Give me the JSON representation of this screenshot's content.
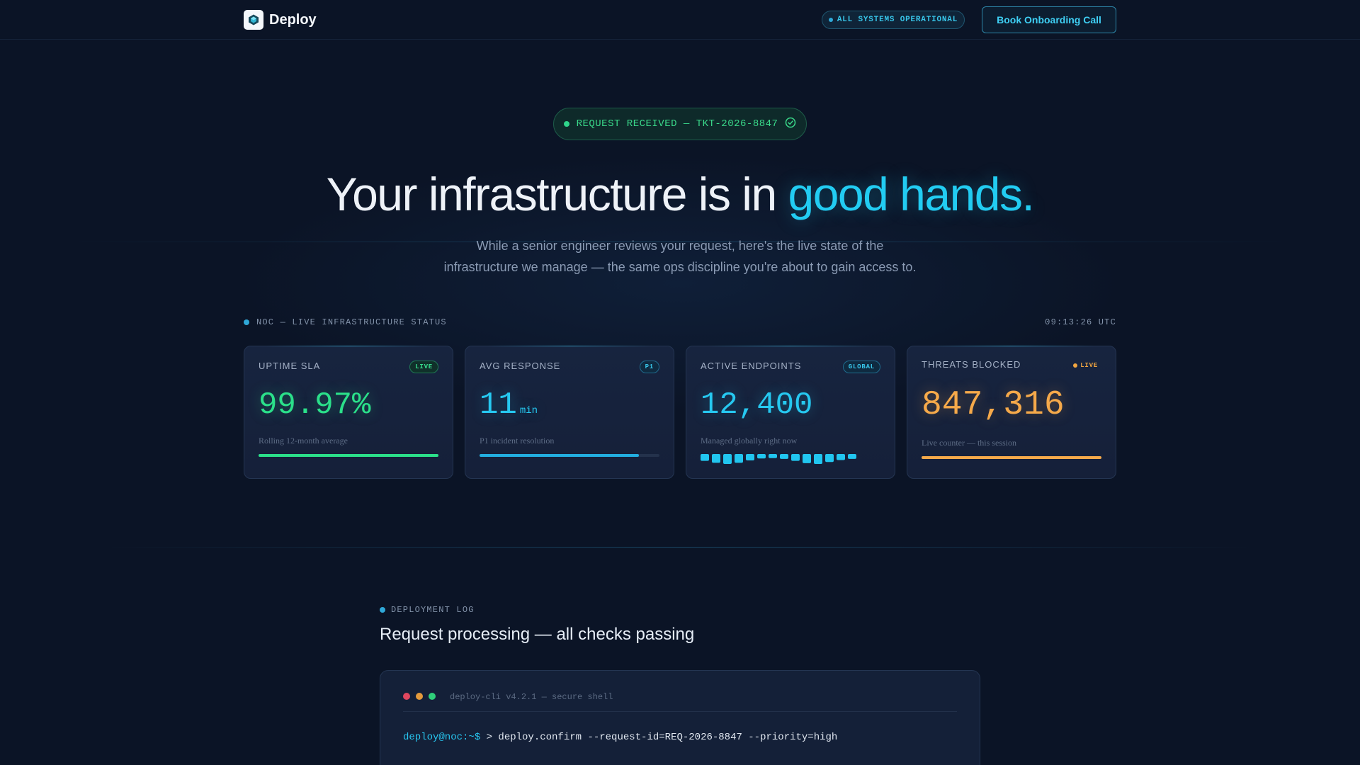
{
  "header": {
    "brand": "Deploy",
    "status": "ALL SYSTEMS OPERATIONAL",
    "cta": "Book Onboarding Call"
  },
  "hero": {
    "ticket": "REQUEST RECEIVED — TKT-2026-8847",
    "title_main": "Your infrastructure is in ",
    "title_accent": "good hands.",
    "subtitle_line1": "While a senior engineer reviews your request, here's the live state of the",
    "subtitle_line2": "infrastructure we manage — the same ops discipline you're about to gain access to."
  },
  "noc": {
    "label": "NOC — LIVE INFRASTRUCTURE STATUS",
    "time": "09:13:26 UTC",
    "cards": [
      {
        "label": "UPTIME SLA",
        "badge": "LIVE",
        "value": "99.97%",
        "caption": "Rolling 12-month average",
        "progress": 1.0
      },
      {
        "label": "AVG RESPONSE",
        "badge": "P1",
        "value": "11",
        "unit": "min",
        "caption": "P1 incident resolution",
        "progress": 0.885
      },
      {
        "label": "ACTIVE ENDPOINTS",
        "badge": "GLOBAL",
        "value": "12,400",
        "caption": "Managed globally right now",
        "spark_levels": [
          0.6,
          0.85,
          1.0,
          0.85,
          0.55,
          0.3,
          0.25,
          0.35,
          0.6,
          0.9,
          1.0,
          0.75,
          0.5,
          0.35
        ]
      },
      {
        "label": "THREATS BLOCKED",
        "badge": "LIVE",
        "value": "847,316",
        "caption": "Live counter — this session",
        "progress": 1.0
      }
    ]
  },
  "log": {
    "eyebrow": "DEPLOYMENT LOG",
    "title": "Request processing — all checks passing",
    "terminal_title": "deploy-cli v4.2.1 — secure shell",
    "prompt": "deploy@noc:~$",
    "command": " > deploy.confirm --request-id=REQ-2026-8847 --priority=high"
  },
  "colors": {
    "background": "#0b1426",
    "accent_cyan": "#22ccf2",
    "success_green": "#2be08a",
    "warning_amber": "#f5a94a"
  },
  "icons": {
    "brand": "deploy-cube-icon",
    "ticket": "check-circle-icon"
  }
}
